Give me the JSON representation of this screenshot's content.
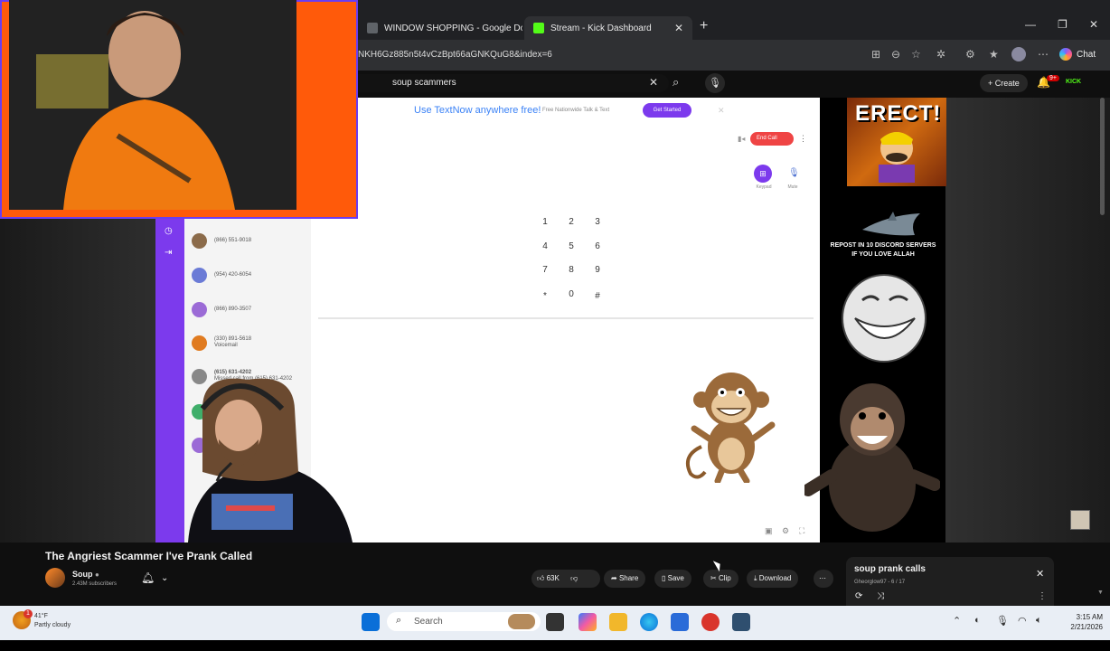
{
  "browser": {
    "tabs": [
      {
        "label": "WINDOW SHOPPING - Google Do",
        "favicon_color": "#5f6368"
      },
      {
        "label": "Stream - Kick Dashboard",
        "favicon_color": "#53fc18"
      }
    ],
    "new_tab_label": "+",
    "url": "NKH6Gz885n5t4vCzBpt66aGNKQuG8&index=6",
    "chat_label": "Chat"
  },
  "youtube": {
    "search_query": "soup scammers",
    "create_label": "Create",
    "notification_count": "9+",
    "kick_badge": "KICK"
  },
  "video_content": {
    "ad_text": "Use TextNow anywhere free!",
    "ad_subtext": "Free Nationwide Talk & Text",
    "get_started_label": "Get Started",
    "end_call_label": "End Call",
    "keypad_label": "Keypad",
    "mute_label": "Mute",
    "keypad_keys": [
      {
        "digit": "1",
        "letters": ""
      },
      {
        "digit": "2",
        "letters": "ABC"
      },
      {
        "digit": "3",
        "letters": "DEF"
      },
      {
        "digit": "4",
        "letters": "GHI"
      },
      {
        "digit": "5",
        "letters": "JKL"
      },
      {
        "digit": "6",
        "letters": "MNO"
      },
      {
        "digit": "7",
        "letters": "PQRS"
      },
      {
        "digit": "8",
        "letters": "TUV"
      },
      {
        "digit": "9",
        "letters": "WXYZ"
      },
      {
        "digit": "*",
        "letters": ""
      },
      {
        "digit": "0",
        "letters": "+"
      },
      {
        "digit": "#",
        "letters": ""
      }
    ],
    "contacts": [
      {
        "number": "(866) 551-9018",
        "sub": "",
        "color": "#8b6b4a"
      },
      {
        "number": "(954) 420-6054",
        "sub": "",
        "color": "#6b7bd6"
      },
      {
        "number": "(866) 890-3507",
        "sub": "",
        "color": "#9b6bd6"
      },
      {
        "number": "(330) 891-5618",
        "sub": "Voicemail",
        "color": "#e07b20"
      },
      {
        "number": "(615) 631-4202",
        "sub": "Missed call from (615) 631-4202",
        "color": "#888"
      },
      {
        "number": "9339",
        "sub": "",
        "color": "#3fae6a"
      },
      {
        "number": "",
        "sub": "",
        "color": "#9b6bd6"
      }
    ],
    "meme_caption": "REPOST IN 10 DISCORD SERVERS IF YOU LOVE ALLAH",
    "meme_title": "ERECT!"
  },
  "video": {
    "title": "The Angriest Scammer I've Prank Called",
    "channel": "Soup",
    "subscribers": "2.43M subscribers",
    "likes": "63K",
    "share_label": "Share",
    "save_label": "Save",
    "clip_label": "Clip",
    "download_label": "Download"
  },
  "playlist": {
    "title": "soup prank calls",
    "subtitle": "Gheorglow97 - 6 / 17"
  },
  "taskbar": {
    "temperature": "41°F",
    "condition": "Partly cloudy",
    "search_placeholder": "Search",
    "time": "3:15 AM",
    "date": "2/21/2026",
    "weather_badge": "1"
  }
}
